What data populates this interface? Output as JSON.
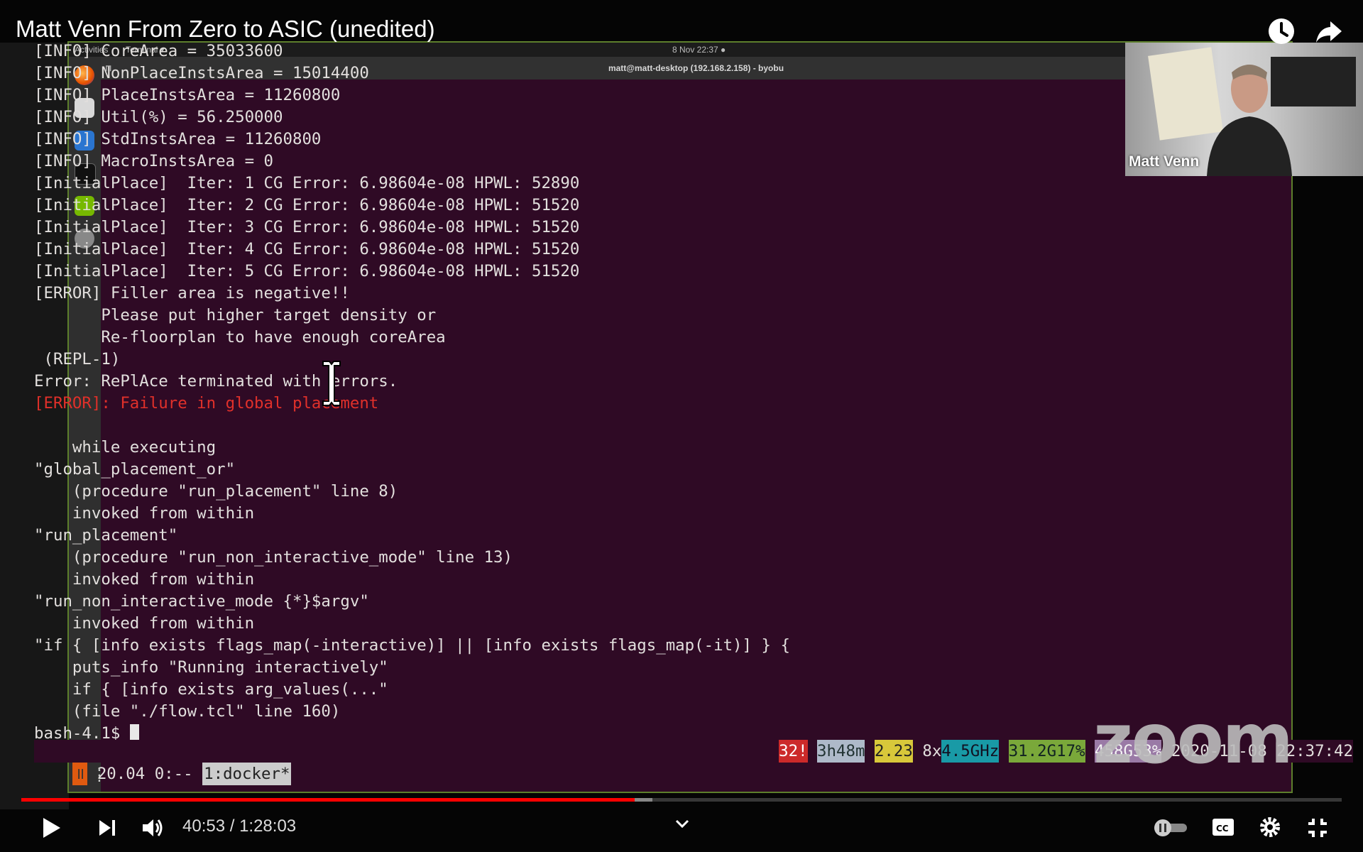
{
  "video": {
    "title": "Matt Venn From Zero to ASIC (unedited)",
    "time_current": "40:53",
    "time_total": "1:28:03",
    "time_display": "40:53 / 1:28:03",
    "progress": 0.4644,
    "buffered": 0.4781
  },
  "desktop": {
    "activities": "Activities",
    "app_menu": "Terminal ▾",
    "clock": "8 Nov  22:37  ●",
    "window_title": "matt@matt-desktop (192.168.2.158) - byobu",
    "tab_marker": "⊓"
  },
  "terminal": {
    "lines": [
      "[INFO] CoreArea = 35033600",
      "[INFO] NonPlaceInstsArea = 15014400",
      "[INFO] PlaceInstsArea = 11260800",
      "[INFO] Util(%) = 56.250000",
      "[INFO] StdInstsArea = 11260800",
      "[INFO] MacroInstsArea = 0",
      "[InitialPlace]  Iter: 1 CG Error: 6.98604e-08 HPWL: 52890",
      "[InitialPlace]  Iter: 2 CG Error: 6.98604e-08 HPWL: 51520",
      "[InitialPlace]  Iter: 3 CG Error: 6.98604e-08 HPWL: 51520",
      "[InitialPlace]  Iter: 4 CG Error: 6.98604e-08 HPWL: 51520",
      "[InitialPlace]  Iter: 5 CG Error: 6.98604e-08 HPWL: 51520",
      "[ERROR] Filler area is negative!!",
      "       Please put higher target density or",
      "       Re-floorplan to have enough coreArea",
      " (REPL-1)",
      "Error: RePlAce terminated with errors."
    ],
    "error_line": "[ERROR]: Failure in global placement",
    "trace_lines": [
      "",
      "    while executing",
      "\"global_placement_or\"",
      "    (procedure \"run_placement\" line 8)",
      "    invoked from within",
      "\"run_placement\"",
      "    (procedure \"run_non_interactive_mode\" line 13)",
      "    invoked from within",
      "\"run_non_interactive_mode {*}$argv\"",
      "    invoked from within",
      "\"if { [info exists flags_map(-interactive)] || [info exists flags_map(-it)] } {",
      "    puts_info \"Running interactively\"",
      "    if { [info exists arg_values(...\"",
      "    (file \"./flow.tcl\" line 160)"
    ],
    "prompt": "bash-4.1$ "
  },
  "byobu": {
    "pause": "॥",
    "os": " 20.04 0:-- ",
    "window": "1:docker*",
    "updates": "32!",
    "uptime": "3h48m",
    "load": "2.23",
    "cpu_count": " 8x",
    "cpu_freq": "4.5GHz",
    "mem": "31.2G17%",
    "disk": "458G53%",
    "datetime": " 2020-11-08 22:37:42"
  },
  "webcam": {
    "name": "Matt Venn"
  },
  "watermark": "zoom",
  "colors": {
    "terminal_bg": "#2f0a25",
    "progress": "#ff0000",
    "error_text": "#e0302a"
  },
  "icons": [
    "watch-later-icon",
    "share-icon",
    "play-icon",
    "next-icon",
    "volume-icon",
    "chevron-down-icon",
    "autoplay-toggle-icon",
    "captions-icon",
    "settings-icon",
    "exit-fullscreen-icon"
  ]
}
